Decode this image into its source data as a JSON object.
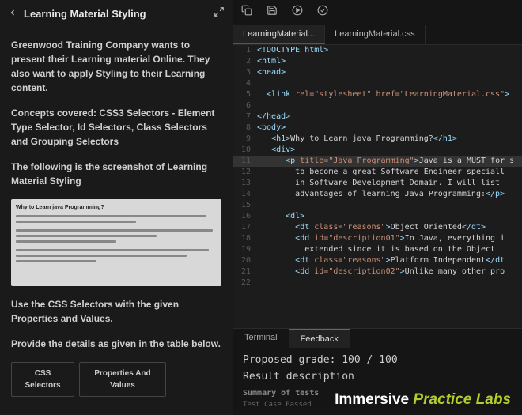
{
  "header": {
    "title": "Learning Material Styling"
  },
  "instructions": {
    "p1": "Greenwood Training Company wants to present their Learning material Online. They also want to apply Styling to their Learning content.",
    "p2": "Concepts covered: CSS3 Selectors - Element Type Selector, Id Selectors, Class Selectors and Grouping Selectors",
    "p3": "The following is the screenshot of Learning Material Styling",
    "p4": "Use the CSS Selectors with the given Properties and Values.",
    "p5": "Provide the details as given in the table below.",
    "screenshot_title": "Why to Learn java Programming?"
  },
  "table": {
    "col1": "CSS Selectors",
    "col2": "Properties And Values"
  },
  "editor": {
    "tabs": [
      {
        "label": "LearningMaterial...",
        "active": true
      },
      {
        "label": "LearningMaterial.css",
        "active": false
      }
    ],
    "lines": [
      {
        "n": 1,
        "html": "<span class='tag'>&lt;!DOCTYPE html&gt;</span>"
      },
      {
        "n": 2,
        "html": "<span class='tag'>&lt;html&gt;</span>"
      },
      {
        "n": 3,
        "html": "<span class='tag'>&lt;head&gt;</span>"
      },
      {
        "n": 4,
        "html": ""
      },
      {
        "n": 5,
        "html": "  <span class='tag'>&lt;link</span> <span class='attr'>rel=\"stylesheet\"</span> <span class='attr'>href=\"LearningMaterial.css\"</span><span class='tag'>&gt;</span>"
      },
      {
        "n": 6,
        "html": ""
      },
      {
        "n": 7,
        "html": "<span class='tag'>&lt;/head&gt;</span>"
      },
      {
        "n": 8,
        "html": "<span class='tag'>&lt;body&gt;</span>"
      },
      {
        "n": 9,
        "html": "   <span class='tag'>&lt;h1&gt;</span><span class='txt'>Why to Learn java Programming?</span><span class='tag'>&lt;/h1&gt;</span>"
      },
      {
        "n": 10,
        "html": "   <span class='tag'>&lt;div&gt;</span>"
      },
      {
        "n": 11,
        "html": "      <span class='tag'>&lt;p</span> <span class='attr'>title=\"Java Programming\"</span><span class='tag'>&gt;</span><span class='txt'>Java is a MUST for s</span>",
        "hl": true
      },
      {
        "n": 12,
        "html": "        <span class='txt'>to become a great Software Engineer speciall</span>"
      },
      {
        "n": 13,
        "html": "        <span class='txt'>in Software Development Domain. I will list </span>"
      },
      {
        "n": 14,
        "html": "        <span class='txt'>advantages of learning Java Programming:</span><span class='tag'>&lt;/p&gt;</span>"
      },
      {
        "n": 15,
        "html": ""
      },
      {
        "n": 16,
        "html": "      <span class='tag'>&lt;dl&gt;</span>"
      },
      {
        "n": 17,
        "html": "        <span class='tag'>&lt;dt</span> <span class='attr'>class=\"reasons\"</span><span class='tag'>&gt;</span><span class='txt'>Object Oriented</span><span class='tag'>&lt;/dt&gt;</span>"
      },
      {
        "n": 18,
        "html": "        <span class='tag'>&lt;dd</span> <span class='attr'>id=\"description01\"</span><span class='tag'>&gt;</span><span class='txt'>In Java, everything i</span>"
      },
      {
        "n": 19,
        "html": "          <span class='txt'>extended since it is based on the Object</span>"
      },
      {
        "n": 20,
        "html": "        <span class='tag'>&lt;dt</span> <span class='attr'>class=\"reasons\"</span><span class='tag'>&gt;</span><span class='txt'>Platform Independent</span><span class='tag'>&lt;/dt</span>"
      },
      {
        "n": 21,
        "html": "        <span class='tag'>&lt;dd</span> <span class='attr'>id=\"description02\"</span><span class='tag'>&gt;</span><span class='txt'>Unlike many other pro</span>"
      },
      {
        "n": 22,
        "html": ""
      }
    ]
  },
  "bottom": {
    "tabs": [
      {
        "label": "Terminal",
        "active": false
      },
      {
        "label": "Feedback",
        "active": true
      }
    ],
    "grade": "Proposed grade: 100 / 100",
    "desc": "Result description",
    "summary": "Summary of tests",
    "test": "Test Case Passed"
  },
  "brand": {
    "w1": "Immersive",
    "w2": "Practice",
    "w3": "Labs"
  }
}
